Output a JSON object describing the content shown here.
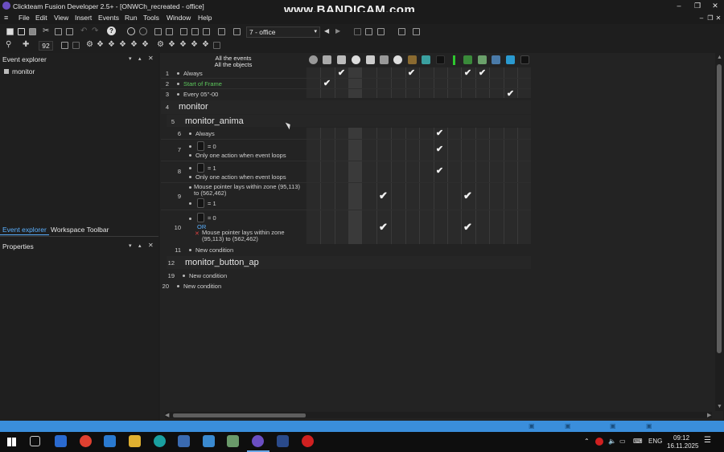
{
  "window": {
    "title": "Clickteam Fusion Developer 2.5+ - [ONWCh_recreated - office]",
    "watermark": "www.BANDICAM.com"
  },
  "menu": [
    "File",
    "Edit",
    "View",
    "Insert",
    "Events",
    "Run",
    "Tools",
    "Window",
    "Help"
  ],
  "toolbar": {
    "frame_select": "7 - office",
    "zoom": "92"
  },
  "left_panel": {
    "event_explorer_title": "Event explorer",
    "tree_item": "monitor",
    "tabs": [
      "Event explorer",
      "Workspace Toolbar"
    ],
    "properties_title": "Properties"
  },
  "editor": {
    "header_events": "All the events",
    "header_objects": "All the objects",
    "rows": [
      {
        "num": "1",
        "text": "Always"
      },
      {
        "num": "2",
        "text": "Start of Frame"
      },
      {
        "num": "3",
        "text": "Every 05''-00"
      },
      {
        "num": "4",
        "text": "monitor"
      },
      {
        "num": "5",
        "text": "monitor_anima"
      },
      {
        "num": "6",
        "text": "Always"
      },
      {
        "num": "7",
        "text": "= 0",
        "sub": "Only one action when event loops"
      },
      {
        "num": "8",
        "text": "= 1",
        "sub": "Only one action when event loops"
      },
      {
        "num": "9",
        "text": "Mouse pointer lays within zone (95,113) to (562,462)",
        "sub": "= 1"
      },
      {
        "num": "10",
        "text": "= 0",
        "or": "OR",
        "sub": "Mouse pointer lays within zone (95,113) to (562,462)"
      },
      {
        "num": "11",
        "text": "New condition"
      },
      {
        "num": "12",
        "text": "monitor_button_ap"
      },
      {
        "num": "19",
        "text": "New condition"
      },
      {
        "num": "20",
        "text": "New condition"
      }
    ]
  },
  "taskbar": {
    "lang": "ENG",
    "time": "09:12",
    "date": "16.11.2025"
  },
  "colors": {
    "accent": "#3a8edb",
    "green_text": "#5cc85c",
    "checkmark": "#f0f0f0"
  }
}
